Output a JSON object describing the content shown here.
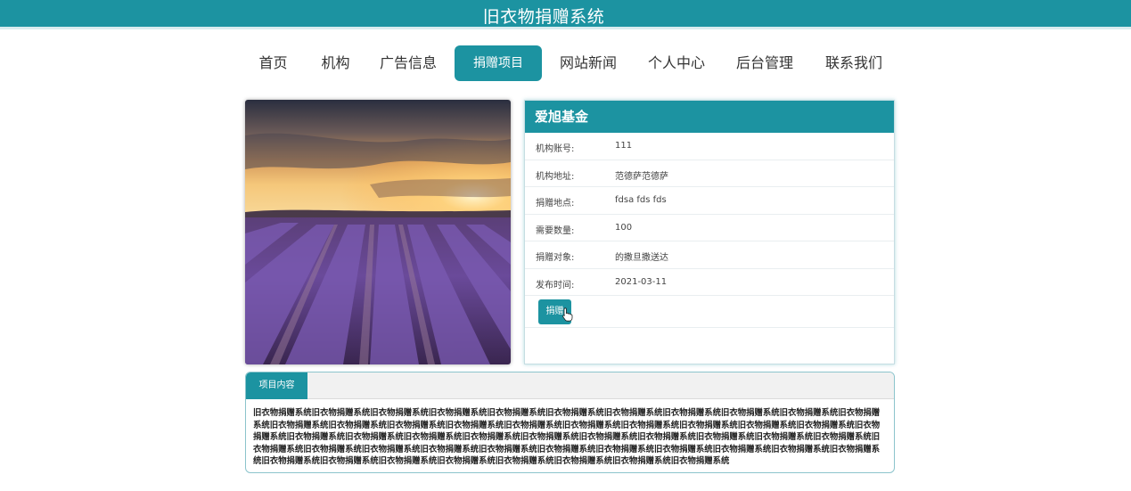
{
  "header": {
    "title": "旧衣物捐赠系统"
  },
  "nav": {
    "items": [
      {
        "label": "首页"
      },
      {
        "label": "机构"
      },
      {
        "label": "广告信息"
      },
      {
        "label": "捐赠项目"
      },
      {
        "label": "网站新闻"
      },
      {
        "label": "个人中心"
      },
      {
        "label": "后台管理"
      },
      {
        "label": "联系我们"
      }
    ],
    "active": "捐赠项目"
  },
  "detail": {
    "org_name": "爱旭基金",
    "fields": [
      {
        "label": "机构账号:",
        "value": "111"
      },
      {
        "label": "机构地址:",
        "value": "范德萨范德萨"
      },
      {
        "label": "捐赠地点:",
        "value": "fdsa fds fds"
      },
      {
        "label": "需要数量:",
        "value": "100"
      },
      {
        "label": "捐赠对象:",
        "value": "的撒旦撒送达"
      },
      {
        "label": "发布时间:",
        "value": "2021-03-11"
      }
    ],
    "donate_label": "捐赠"
  },
  "content": {
    "tab_label": "项目内容",
    "text": "旧衣物捐赠系统旧衣物捐赠系统旧衣物捐赠系统旧衣物捐赠系统旧衣物捐赠系统旧衣物捐赠系统旧衣物捐赠系统旧衣物捐赠系统旧衣物捐赠系统旧衣物捐赠系统旧衣物捐赠系统旧衣物捐赠系统旧衣物捐赠系统旧衣物捐赠系统旧衣物捐赠系统旧衣物捐赠系统旧衣物捐赠系统旧衣物捐赠系统旧衣物捐赠系统旧衣物捐赠系统旧衣物捐赠系统旧衣物捐赠系统旧衣物捐赠系统旧衣物捐赠系统旧衣物捐赠系统旧衣物捐赠系统旧衣物捐赠系统旧衣物捐赠系统旧衣物捐赠系统旧衣物捐赠系统旧衣物捐赠系统旧衣物捐赠系统旧衣物捐赠系统旧衣物捐赠系统旧衣物捐赠系统旧衣物捐赠系统旧衣物捐赠系统旧衣物捐赠系统旧衣物捐赠系统旧衣物捐赠系统旧衣物捐赠系统旧衣物捐赠系统旧衣物捐赠系统旧衣物捐赠系统旧衣物捐赠系统旧衣物捐赠系统旧衣物捐赠系统旧衣物捐赠系统旧衣物捐赠系统旧衣物捐赠系统旧衣物捐赠系统"
  },
  "colors": {
    "accent": "#1c93a1"
  },
  "icons": {
    "cursor": "hand-pointer-icon"
  }
}
